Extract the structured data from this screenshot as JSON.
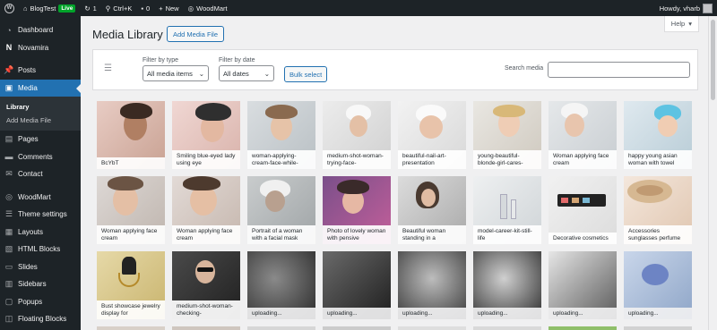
{
  "adminbar": {
    "site_name": "BlogTest",
    "live_badge": "Live",
    "updates_count": "1",
    "shortcut": "Ctrl+K",
    "comments_count": "0",
    "new_label": "New",
    "woodmart_label": "WoodMart",
    "greeting": "Howdy, vharb"
  },
  "sidebar": {
    "items": [
      {
        "label": "Dashboard",
        "icon": "dashboard-icon"
      },
      {
        "label": "Novamira",
        "icon": "novamira-icon"
      },
      {
        "label": "Posts",
        "icon": "pin-icon"
      },
      {
        "label": "Media",
        "icon": "media-icon"
      },
      {
        "label": "Pages",
        "icon": "pages-icon"
      },
      {
        "label": "Comments",
        "icon": "comments-icon"
      },
      {
        "label": "Contact",
        "icon": "mail-icon"
      },
      {
        "label": "WoodMart",
        "icon": "woodmart-icon"
      },
      {
        "label": "Theme settings",
        "icon": "sliders-icon"
      },
      {
        "label": "Layouts",
        "icon": "layouts-icon"
      },
      {
        "label": "HTML Blocks",
        "icon": "html-icon"
      },
      {
        "label": "Slides",
        "icon": "slides-icon"
      },
      {
        "label": "Sidebars",
        "icon": "sidebars-icon"
      },
      {
        "label": "Popups",
        "icon": "popups-icon"
      },
      {
        "label": "Floating Blocks",
        "icon": "floating-icon"
      }
    ],
    "submenu": [
      "Library",
      "Add Media File"
    ]
  },
  "main": {
    "title": "Media Library",
    "add_button": "Add Media File",
    "help": "Help",
    "filter_type_label": "Filter by type",
    "filter_type_value": "All media items",
    "filter_date_label": "Filter by date",
    "filter_date_value": "All dates",
    "bulk_select": "Bulk select",
    "search_label": "Search media"
  },
  "tiles": [
    {
      "caption": "BcYbT"
    },
    {
      "caption": "Smiling blue-eyed lady using eye"
    },
    {
      "caption": "woman-applying-cream-face-while-"
    },
    {
      "caption": "medium-shot-woman-trying-face-"
    },
    {
      "caption": "beautiful-nail-art-presentation"
    },
    {
      "caption": "young-beautiful-blonde-girl-cares-"
    },
    {
      "caption": "Woman applying face cream"
    },
    {
      "caption": "happy young asian woman with towel"
    },
    {
      "caption": "Woman applying face cream"
    },
    {
      "caption": "Woman applying face cream"
    },
    {
      "caption": "Portrait of a woman with a facial mask"
    },
    {
      "caption": "Photo of lovely woman with pensive"
    },
    {
      "caption": "Beautiful woman standing in a"
    },
    {
      "caption": "model-career-kit-still-life"
    },
    {
      "caption": "Decorative cosmetics"
    },
    {
      "caption": "Accessories sunglasses perfume"
    },
    {
      "caption": "Bust showcase jewelry display for"
    },
    {
      "caption": "medium-shot-woman-checking-"
    },
    {
      "caption": "uploading..."
    },
    {
      "caption": "uploading..."
    },
    {
      "caption": "uploading..."
    },
    {
      "caption": "uploading..."
    },
    {
      "caption": "uploading..."
    },
    {
      "caption": "uploading..."
    }
  ]
}
